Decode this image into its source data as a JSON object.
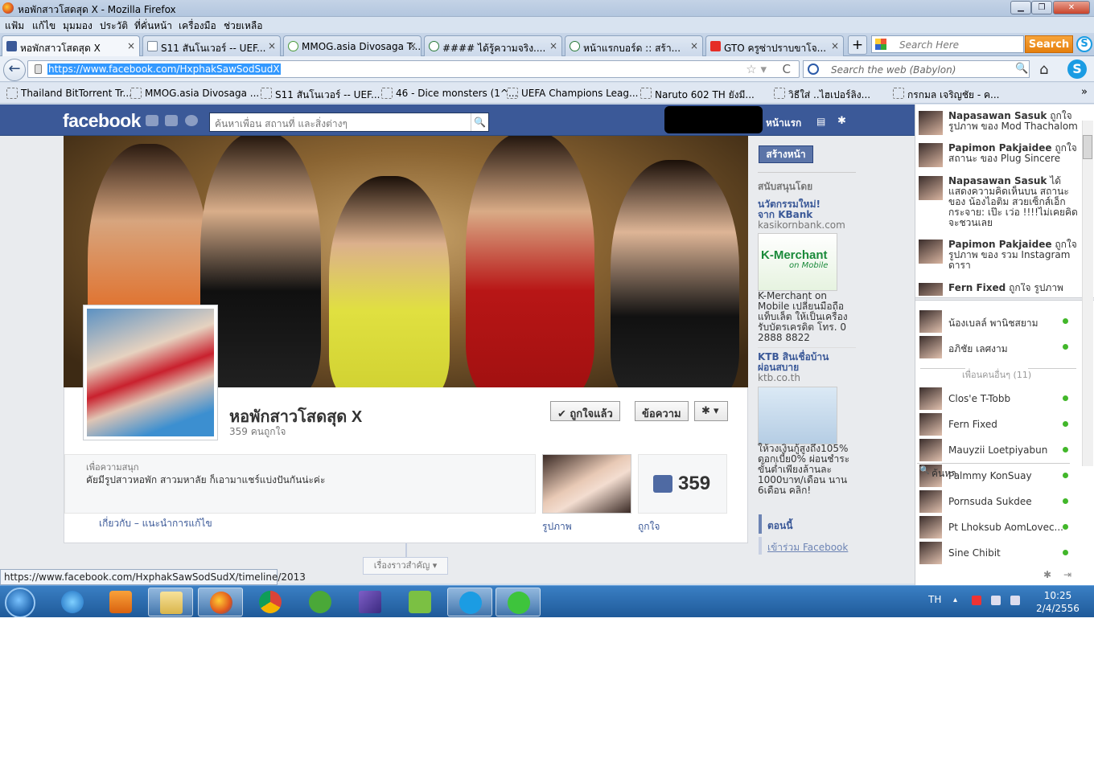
{
  "window": {
    "title": "หอพักสาวโสดสุด X - Mozilla Firefox",
    "min": "▁",
    "max": "❐",
    "close": "✕"
  },
  "menu": [
    "แฟ้ม",
    "แก้ไข",
    "มุมมอง",
    "ประวัติ",
    "ที่คั่นหน้า",
    "เครื่องมือ",
    "ช่วยเหลือ"
  ],
  "tabs": [
    {
      "label": "หอพักสาวโสดสุด X"
    },
    {
      "label": "S11 สันโนเวอร์ -- UEF..."
    },
    {
      "label": "MMOG.asia Divosaga T..."
    },
    {
      "label": "#### ได้รู้ความจริง...."
    },
    {
      "label": "หน้าแรกบอร์ด :: สร้า..."
    },
    {
      "label": "GTO ครูซ่าปราบขาโจ..."
    }
  ],
  "toolbar": {
    "tab_close": "×",
    "new_tab": "+",
    "search_placeholder": "Search Here",
    "search_button": "Search",
    "url": "https://www.facebook.com/HxphakSawSodSudX",
    "web_search_placeholder": "Search the web (Babylon)",
    "star": "☆ ▾",
    "reload": "C",
    "home": "⌂",
    "skype": "S"
  },
  "bookmarks": [
    {
      "label": "Thailand BitTorrent Tr..."
    },
    {
      "label": "MMOG.asia Divosaga ..."
    },
    {
      "label": "S11 สันโนเวอร์ -- UEF..."
    },
    {
      "label": "46 - Dice monsters (1^..."
    },
    {
      "label": "UEFA Champions Leag..."
    },
    {
      "label": "Naruto 602 TH ยังมี..."
    },
    {
      "label": "วิธีใส่ ..ไฮเปอร์ลิง..."
    },
    {
      "label": "กรกมล เจริญชัย - ค..."
    }
  ],
  "facebook": {
    "logo": "facebook",
    "search_placeholder": "ค้นหาเพื่อน สถานที่ และสิ่งต่างๆ",
    "search_icon": "🔍",
    "home": "หน้าแรก",
    "nav_icon": "▤",
    "settings_icon": "✱",
    "page": {
      "name": "หอพักสาวโสดสุด X",
      "likes_text": "359 คนถูกใจ",
      "liked_button": "✔ ถูกใจแล้ว",
      "message_button": "ข้อความ",
      "gear_button": "✱ ▾",
      "about_label": "เพื่อความสนุก",
      "about_text": "คัยมีรูปสาวหอพัก สาวมหาลัย ก็เอามาแชร์แบ่งปันกันน่ะค่ะ",
      "about_links": "เกี่ยวกับ – แนะนำการแก้ไข",
      "likes_count": "359",
      "photos_label": "รูปภาพ",
      "likes_label": "ถูกใจ",
      "highlights": "เรื่องราวสำคัญ ▾"
    },
    "ads": {
      "create_page": "สร้างหน้า",
      "sponsored": "สนับสนุนโดย",
      "ad1": {
        "title_1": "นวัตกรรมใหม่!",
        "title_2": "จาก KBank",
        "url": "kasikornbank.com",
        "image_title": "K-Merchant",
        "image_sub": "on Mobile",
        "text": [
          "K-Merchant on",
          "Mobile เปลี่ยนมือถือ",
          "แท็บเล็ต ให้เป็นเครื่อง",
          "รับบัตรเครดิต โทร. 0",
          "2888 8822"
        ]
      },
      "ad2": {
        "title_1": "KTB สินเชื่อบ้าน",
        "title_2": "ผ่อนสบาย",
        "url": "ktb.co.th",
        "text": [
          "ให้วงเงินกู้สูงถึง105%",
          "ดอกเบี้ย0% ผ่อนชำระ",
          "ขั้นต่ำเพียงล้านละ",
          "1000บาท/เดือน นาน",
          "6เดือน คลิก!"
        ]
      },
      "now": "ตอนนี้",
      "join": "เข้าร่วม Facebook"
    },
    "ticker": [
      {
        "name": "Napasawan Sasuk",
        "text": "ถูกใจ รูปภาพ ของ Mod Thachalom"
      },
      {
        "name": "Papimon Pakjaidee",
        "text": "ถูกใจ สถานะ ของ Plug Sincere"
      },
      {
        "name": "Napasawan Sasuk",
        "text": "ได้ แสดงความคิดเห็นบน สถานะ ของ น้องไอติม สวยเซ็กส์เอ็ก กระจาย: เป๊ะ เว่อ !!!!ไม่เคยคิดจะชวนเลย"
      },
      {
        "name": "Papimon Pakjaidee",
        "text": "ถูกใจ รูปภาพ ของ รวม Instagram ดารา"
      },
      {
        "name": "Fern Fixed",
        "text": "ถูกใจ รูปภาพ"
      }
    ],
    "friends_top": [
      {
        "name": "น้องเบลล์ พานิชสยาม"
      },
      {
        "name": "อภิชัย เลศงาม"
      }
    ],
    "others_label": "เพื่อนคนอื่นๆ (11)",
    "friends": [
      {
        "name": "Clos'e T-Tobb"
      },
      {
        "name": "Fern Fixed"
      },
      {
        "name": "Mauyzii Loetpiyabun"
      },
      {
        "name": "Palmmy KonSuay"
      },
      {
        "name": "Pornsuda Sukdee"
      },
      {
        "name": "Pt Lhoksub AomLovec..."
      },
      {
        "name": "Sine Chibit"
      }
    ],
    "chat_search": "ค้นหา",
    "chat_gear": "✱",
    "chat_popout": "⇥"
  },
  "status_url": "https://www.facebook.com/HxphakSawSodSudX/timeline/2013",
  "taskbar": {
    "language": "TH",
    "tray_arrow": "▴",
    "time": "10:25",
    "date": "2/4/2556"
  }
}
